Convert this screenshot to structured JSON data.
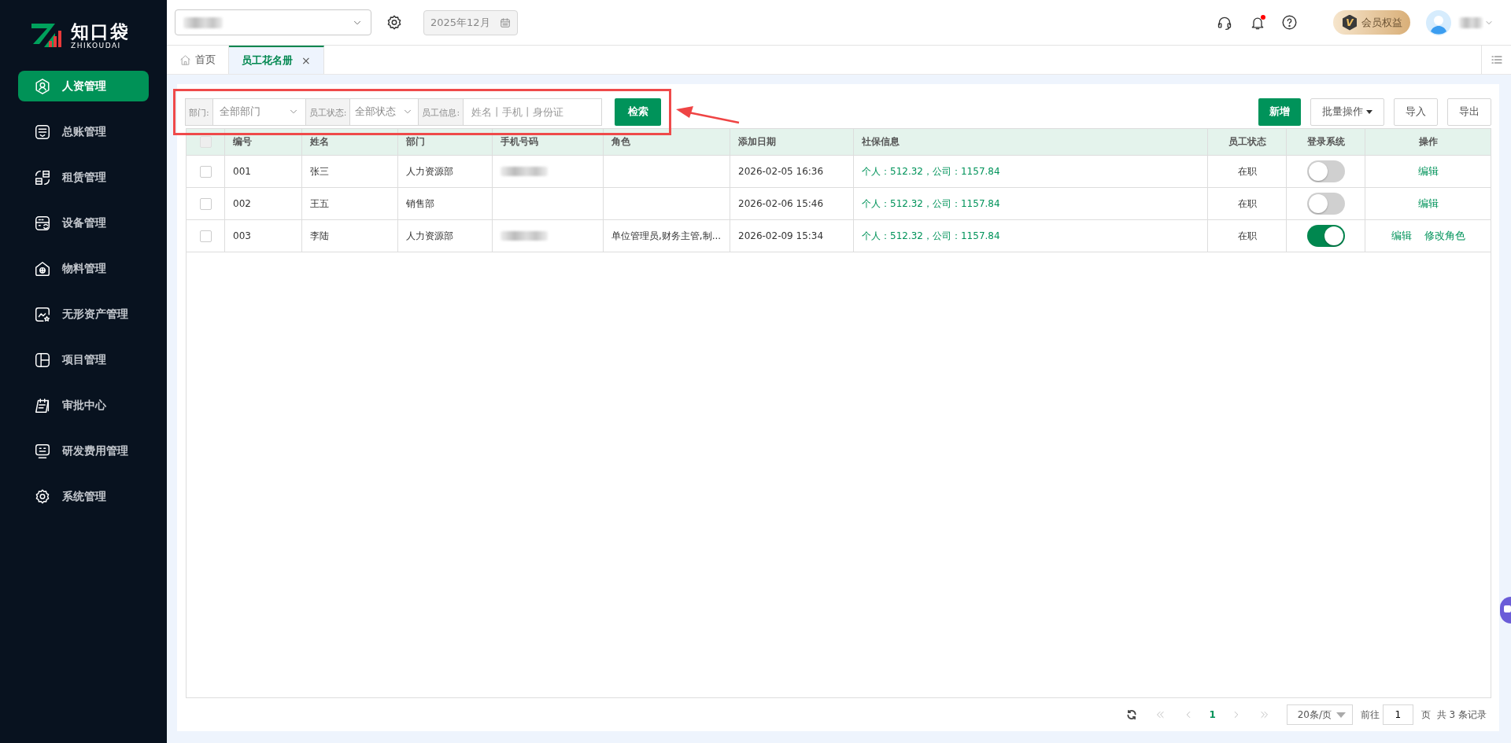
{
  "logo": {
    "name": "知口袋",
    "subtitle": "ZHIKOUDAI"
  },
  "sidebar": {
    "items": [
      {
        "label": "人资管理",
        "selected": true
      },
      {
        "label": "总账管理",
        "selected": false
      },
      {
        "label": "租赁管理",
        "selected": false
      },
      {
        "label": "设备管理",
        "selected": false
      },
      {
        "label": "物料管理",
        "selected": false
      },
      {
        "label": "无形资产管理",
        "selected": false
      },
      {
        "label": "项目管理",
        "selected": false
      },
      {
        "label": "审批中心",
        "selected": false
      },
      {
        "label": "研发费用管理",
        "selected": false
      },
      {
        "label": "系统管理",
        "selected": false
      }
    ]
  },
  "header": {
    "date": "2025年12月",
    "notification_dot": true,
    "vip": {
      "mark": "V",
      "label": "会员权益"
    }
  },
  "tabs": [
    {
      "label": "首页",
      "selected": false,
      "home": true
    },
    {
      "label": "员工花名册",
      "selected": true,
      "close": "×"
    }
  ],
  "filters": [
    {
      "label": "部门:",
      "value": "全部部门"
    },
    {
      "label": "员工状态:",
      "value": "全部状态"
    },
    {
      "label": "员工信息:",
      "placeholder": "姓名丨手机丨身份证"
    }
  ],
  "search_button": "检索",
  "actions": [
    {
      "label": "新增",
      "kind": "primary"
    },
    {
      "label": "批量操作",
      "kind": "dropdown"
    },
    {
      "label": "导入",
      "kind": "plain"
    },
    {
      "label": "导出",
      "kind": "plain"
    }
  ],
  "table": {
    "select_all": {
      "checked": false
    },
    "columns": [
      "编号",
      "姓名",
      "部门",
      "手机号码",
      "角色",
      "添加日期",
      "社保信息",
      "员工状态",
      "登录系统",
      "操作"
    ],
    "rows": [
      {
        "checked": false,
        "id": "001",
        "name": "张三",
        "dept": "人力资源部",
        "phone_blurred": true,
        "role": "",
        "date": "2026-02-05 16:36",
        "social": "个人：512.32，公司：1157.84",
        "status": "在职",
        "login_enabled": false,
        "ops": [
          "编辑"
        ]
      },
      {
        "checked": false,
        "id": "002",
        "name": "王五",
        "dept": "销售部",
        "phone_blurred": false,
        "role": "",
        "date": "2026-02-06 15:46",
        "social": "个人：512.32，公司：1157.84",
        "status": "在职",
        "login_enabled": false,
        "ops": [
          "编辑"
        ]
      },
      {
        "checked": false,
        "id": "003",
        "name": "李陆",
        "dept": "人力资源部",
        "phone_blurred": true,
        "role": "单位管理员,财务主管,制...",
        "date": "2026-02-09 15:34",
        "social": "个人：512.32，公司：1157.84",
        "status": "在职",
        "login_enabled": true,
        "ops": [
          "编辑",
          "修改角色"
        ]
      }
    ]
  },
  "pagination": {
    "pages": [
      {
        "label": "1",
        "selected": true
      }
    ],
    "page_size": "20条/页",
    "goto_label": "前往",
    "goto_value": "1",
    "page_unit": "页",
    "total": "共 3 条记录"
  }
}
